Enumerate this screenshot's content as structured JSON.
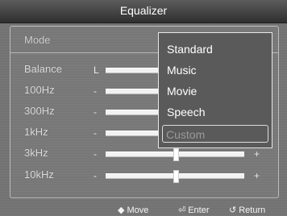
{
  "window": {
    "title": "Equalizer"
  },
  "mode": {
    "label": "Mode"
  },
  "rows": [
    {
      "label": "Balance",
      "left_mark": "L",
      "right_mark": "",
      "level": 0.5
    },
    {
      "label": "100Hz",
      "left_mark": "-",
      "right_mark": "",
      "level": 0.5
    },
    {
      "label": "300Hz",
      "left_mark": "-",
      "right_mark": "",
      "level": 0.5
    },
    {
      "label": "1kHz",
      "left_mark": "-",
      "right_mark": "",
      "level": 0.5
    },
    {
      "label": "3kHz",
      "left_mark": "-",
      "right_mark": "+",
      "level": 0.5
    },
    {
      "label": "10kHz",
      "left_mark": "-",
      "right_mark": "+",
      "level": 0.5
    }
  ],
  "dropdown": {
    "options": [
      "Standard",
      "Music",
      "Movie",
      "Speech",
      "Custom"
    ],
    "highlighted": "Custom"
  },
  "footer": {
    "move": {
      "icon": "◆",
      "label": "Move"
    },
    "enter": {
      "icon": "⏎",
      "label": "Enter"
    },
    "return": {
      "icon": "↺",
      "label": "Return"
    }
  }
}
